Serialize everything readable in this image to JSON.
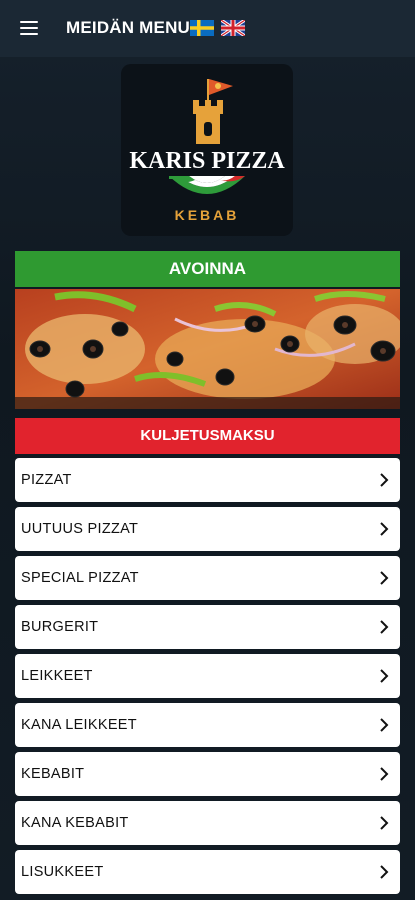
{
  "header": {
    "title": "MEIDÄN MENU",
    "language_flags": [
      "swedish-flag",
      "uk-flag"
    ]
  },
  "logo": {
    "name": "KARIS PIZZA",
    "subtitle": "KEBAB"
  },
  "status": {
    "open_label": "AVOINNA",
    "open_color": "#2f9a31"
  },
  "delivery": {
    "label": "KULJETUSMAKSU",
    "color": "#e1232d"
  },
  "menu": {
    "items": [
      {
        "label": "PIZZAT"
      },
      {
        "label": "UUTUUS PIZZAT"
      },
      {
        "label": "SPECIAL PIZZAT"
      },
      {
        "label": "BURGERIT"
      },
      {
        "label": "LEIKKEET"
      },
      {
        "label": "KANA LEIKKEET"
      },
      {
        "label": "KEBABIT"
      },
      {
        "label": "KANA KEBABIT"
      },
      {
        "label": "LISUKKEET"
      }
    ]
  }
}
